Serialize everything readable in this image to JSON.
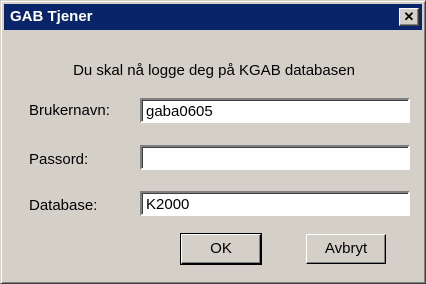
{
  "window": {
    "title": "GAB Tjener",
    "close_symbol": "✕"
  },
  "message": "Du skal nå logge deg på KGAB databasen",
  "fields": {
    "username": {
      "label": "Brukernavn:",
      "value": "gaba0605"
    },
    "password": {
      "label": "Passord:",
      "value": ""
    },
    "database": {
      "label": "Database:",
      "value": "K2000"
    }
  },
  "buttons": {
    "ok": "OK",
    "cancel": "Avbryt"
  }
}
